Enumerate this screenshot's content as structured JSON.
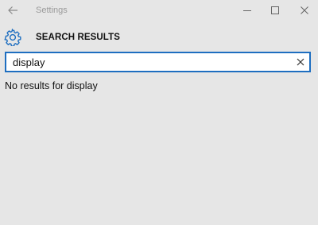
{
  "window": {
    "title": "Settings",
    "back_icon": "back-arrow-icon",
    "minimize_icon": "minimize-icon",
    "maximize_icon": "maximize-icon",
    "close_icon": "close-icon"
  },
  "header": {
    "icon": "gear-icon",
    "title": "SEARCH RESULTS",
    "accent_color": "#1e6ec0"
  },
  "search": {
    "value": "display",
    "clear_icon": "clear-x-icon"
  },
  "results": {
    "message": "No results for display"
  },
  "colors": {
    "background": "#e6e6e6",
    "accent": "#1e6ec0",
    "title_text": "#9a9a9a"
  }
}
